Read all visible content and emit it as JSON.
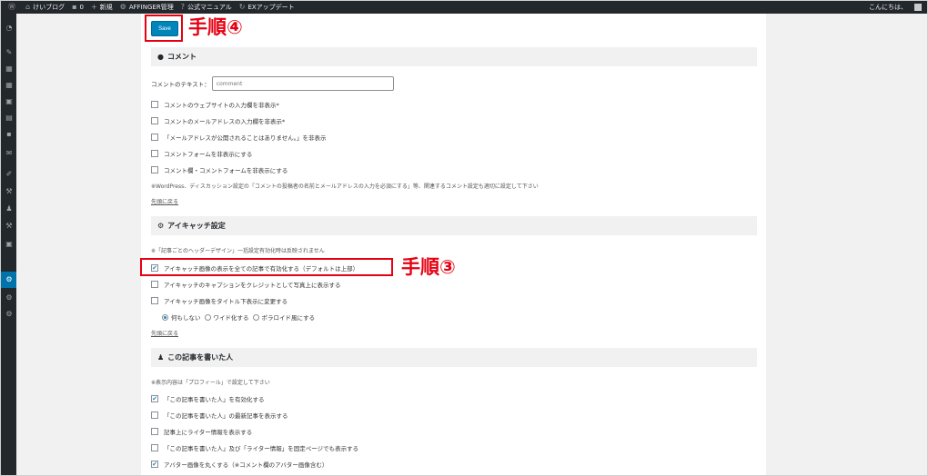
{
  "adminbar": {
    "site": "けいブログ",
    "comments_count": "0",
    "new": "新規",
    "affinger": "AFFINGER管理",
    "manual": "公式マニュアル",
    "ex_update": "EXアップデート",
    "greeting": "こんにちは、"
  },
  "save_label": "Save",
  "annotations": {
    "step4": "手順④",
    "step3": "手順③"
  },
  "comment_section": {
    "title": "コメント",
    "text_label": "コメントのテキスト：",
    "text_placeholder": "comment",
    "options": [
      {
        "label": "コメントのウェブサイトの入力欄を非表示*",
        "checked": false
      },
      {
        "label": "コメントのメールアドレスの入力欄を非表示*",
        "checked": false
      },
      {
        "label": "「メールアドレスが公開されることはありません。」を非表示",
        "checked": false
      },
      {
        "label": "コメントフォームを非表示にする",
        "checked": false
      },
      {
        "label": "コメント欄・コメントフォームを非表示にする",
        "checked": false
      }
    ],
    "note": "※WordPress、ディスカッション設定の「コメントの投稿者の名前とメールアドレスの入力を必須にする」等、関連するコメント設定も適切に設定して下さい",
    "top_link": "先頭に戻る"
  },
  "eyecatch_section": {
    "title": "アイキャッチ設定",
    "note": "※「記事ごとのヘッダーデザイン」一括設定有効化時は反映されません",
    "options": [
      {
        "label": "アイキャッチ画像の表示を全ての記事で有効化する（デフォルトは上部）",
        "checked": true
      },
      {
        "label": "アイキャッチのキャプションをクレジットとして写真上に表示する",
        "checked": false
      },
      {
        "label": "アイキャッチ画像をタイトル下表示に変更する",
        "checked": false
      }
    ],
    "radios": [
      {
        "label": "何もしない",
        "selected": true
      },
      {
        "label": "ワイド化する",
        "selected": false
      },
      {
        "label": "ポラロイド風にする",
        "selected": false
      }
    ],
    "top_link": "先頭に戻る"
  },
  "author_section": {
    "title": "この記事を書いた人",
    "note": "※表示内容は「プロフィール」で設定して下さい",
    "options": [
      {
        "label": "「この記事を書いた人」を有効化する",
        "checked": true
      },
      {
        "label": "「この記事を書いた人」の最新記事を表示する",
        "checked": false
      },
      {
        "label": "記事上にライター情報を表示する",
        "checked": false
      },
      {
        "label": "「この記事を書いた人」及び「ライター情報」を固定ページでも表示する",
        "checked": false
      },
      {
        "label": "アバター画像を丸くする（※コメント欄のアバター画像含む）",
        "checked": true
      }
    ]
  },
  "colors": {
    "accent": "#0085ba",
    "annotation_red": "#e60012",
    "adminbar_bg": "#23282d",
    "menu_active": "#0073aa"
  }
}
